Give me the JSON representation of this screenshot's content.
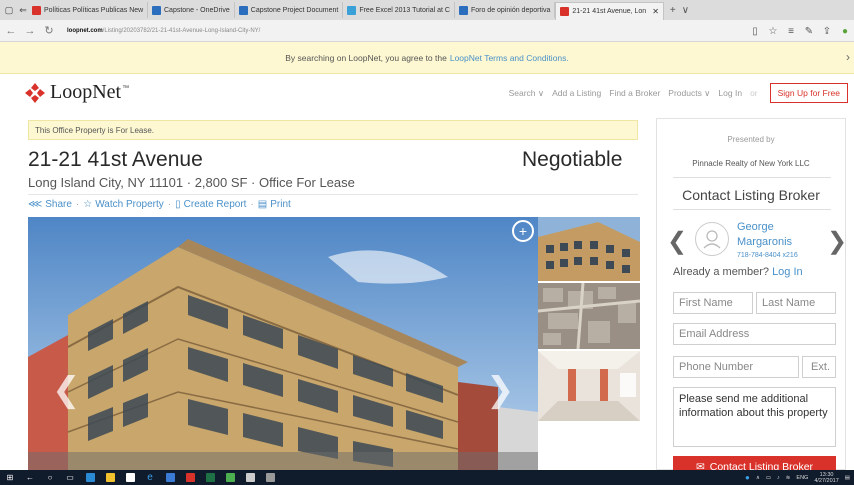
{
  "browser": {
    "tabs": [
      {
        "label": "Políticas Políticas Publicas New",
        "color": "#d8322a",
        "active": false
      },
      {
        "label": "Capstone - OneDrive",
        "color": "#2a6ebd",
        "active": false
      },
      {
        "label": "Capstone Project Document",
        "color": "#2a6ebd",
        "active": false
      },
      {
        "label": "Free Excel 2013 Tutorial at C",
        "color": "#3aa0d8",
        "active": false
      },
      {
        "label": "Foro de opinión deportiva",
        "color": "#2a6ebd",
        "active": false
      },
      {
        "label": "21-21 41st Avenue, Lon",
        "color": "#d8322a",
        "active": true
      }
    ],
    "url_host": "loopnet.com",
    "url_path": "/Listing/20203782/21-21-41st-Avenue-Long-Island-City-NY/"
  },
  "notice": {
    "text": "By searching on LoopNet, you agree to the",
    "link": "LoopNet Terms and Conditions.",
    "close": "›"
  },
  "header": {
    "logo_text": "LoopNet",
    "logo_tm": "™",
    "nav": [
      "Search ∨",
      "Add a Listing",
      "Find a Broker",
      "Products ∨",
      "Log In"
    ],
    "nav_sep": "or",
    "signup": "Sign Up for Free"
  },
  "listing": {
    "banner": "This Office Property is For Lease.",
    "title": "21-21 41st Avenue",
    "price": "Negotiable",
    "subtitle": "Long Island City, NY 11101 · 2,800 SF · Office For Lease",
    "actions": {
      "share": "Share",
      "watch": "Watch Property",
      "report": "Create Report",
      "print": "Print",
      "sep": "·"
    }
  },
  "panel": {
    "presented_by": "Presented by",
    "company": "Pinnacle Realty of New York LLC",
    "contact_title": "Contact Listing Broker",
    "broker_first": "George",
    "broker_last": "Margaronis",
    "broker_phone": "718-784-8404 x216",
    "member_text": "Already a member?",
    "member_login": "Log In",
    "first_name": "First Name",
    "last_name": "Last Name",
    "email": "Email Address",
    "phone": "Phone Number",
    "ext": "Ext.",
    "message": "Please send me additional information about this property",
    "button": "Contact Listing Broker"
  },
  "taskbar": {
    "lang": "ENG",
    "time": "13:30",
    "date": "4/27/2017"
  },
  "icons": {
    "accent": "#d8322a",
    "link": "#4a90c8"
  }
}
